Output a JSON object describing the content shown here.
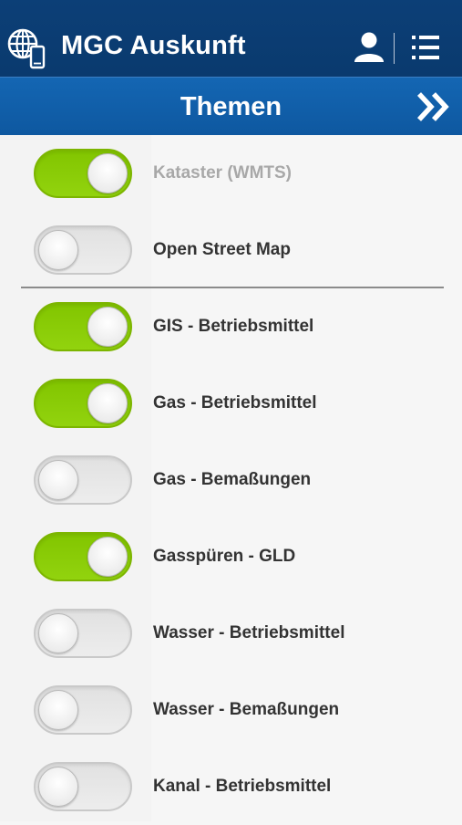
{
  "header": {
    "title": "MGC Auskunft",
    "logo_icon": "globe-device-icon",
    "user_icon": "user-icon",
    "menu_icon": "list-menu-icon"
  },
  "subheader": {
    "title": "Themen",
    "forward_icon": "double-chevron-right-icon"
  },
  "colors": {
    "header_bg": "#0c3f77",
    "subheader_bg": "#1466b3",
    "toggle_on": "#8ccc00",
    "toggle_off": "#e6e6e6"
  },
  "layers": [
    {
      "label": "Kataster (WMTS)",
      "on": true,
      "disabled": true
    },
    {
      "label": "Open Street Map",
      "on": false,
      "disabled": false
    },
    {
      "label": "GIS - Betriebsmittel",
      "on": true,
      "disabled": false
    },
    {
      "label": "Gas - Betriebsmittel",
      "on": true,
      "disabled": false
    },
    {
      "label": "Gas - Bemaßungen",
      "on": false,
      "disabled": false
    },
    {
      "label": "Gasspüren - GLD",
      "on": true,
      "disabled": false
    },
    {
      "label": "Wasser - Betriebsmittel",
      "on": false,
      "disabled": false
    },
    {
      "label": "Wasser - Bemaßungen",
      "on": false,
      "disabled": false
    },
    {
      "label": "Kanal - Betriebsmittel",
      "on": false,
      "disabled": false
    }
  ]
}
